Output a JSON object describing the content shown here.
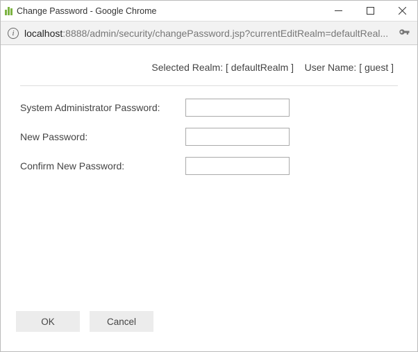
{
  "window": {
    "title": "Change Password - Google Chrome"
  },
  "address": {
    "host": "localhost",
    "rest": ":8888/admin/security/changePassword.jsp?currentEditRealm=defaultReal..."
  },
  "header": {
    "realm_label": "Selected Realm:",
    "realm_value": "[ defaultRealm ]",
    "user_label": "User Name:",
    "user_value": "[ guest ]"
  },
  "form": {
    "admin_pw_label": "System Administrator Password:",
    "new_pw_label": "New Password:",
    "confirm_pw_label": "Confirm New Password:",
    "admin_pw_value": "",
    "new_pw_value": "",
    "confirm_pw_value": ""
  },
  "buttons": {
    "ok": "OK",
    "cancel": "Cancel"
  }
}
